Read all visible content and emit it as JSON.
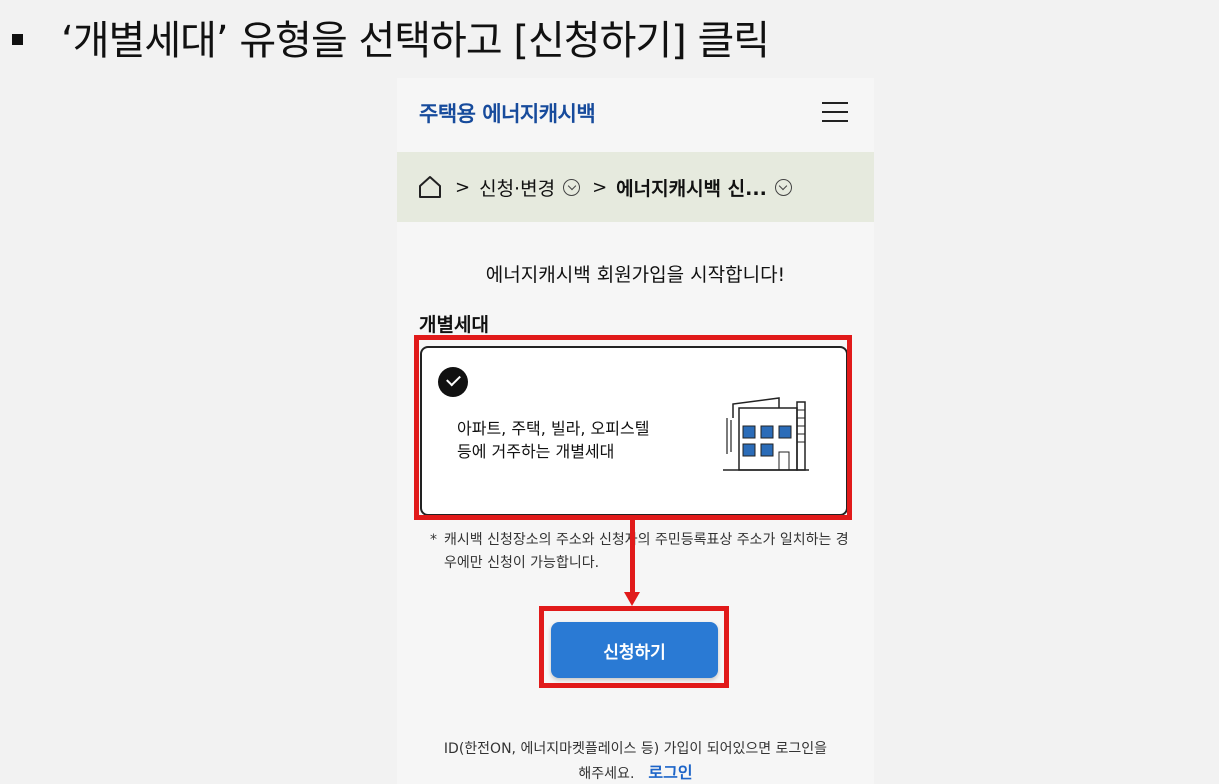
{
  "slide_heading": "‘개별세대’ 유형을 선택하고 [신청하기] 클릭",
  "site": {
    "logo_text": "주택용 에너지캐시백"
  },
  "breadcrumb": {
    "home_icon": "home-icon",
    "item1": "신청·변경",
    "item2": "에너지캐시백 신..."
  },
  "welcome": "에너지캐시백 회원가입을 시작합니다!",
  "type_section": {
    "title": "개별세대",
    "card_line1": "아파트, 주택, 빌라, 오피스텔",
    "card_line2": "등에 거주하는 개별세대",
    "selected_icon": "check-circle-icon",
    "illustration_icon": "building-icon"
  },
  "note": {
    "star": "*",
    "text": "캐시백 신청장소의 주소와 신청자의 주민등록표상 주소가 일치하는 경우에만 신청이 가능합니다."
  },
  "apply_button": "신청하기",
  "login_note": {
    "line1": "ID(한전ON, 에너지마켓플레이스 등) 가입이 되어있으면 로그인을",
    "line2": "해주세요.",
    "link": "로그인"
  },
  "colors": {
    "highlight": "#e11a1a",
    "button": "#2a7ad4",
    "logo": "#174b9c",
    "breadcrumb_bg": "#e6eade"
  }
}
